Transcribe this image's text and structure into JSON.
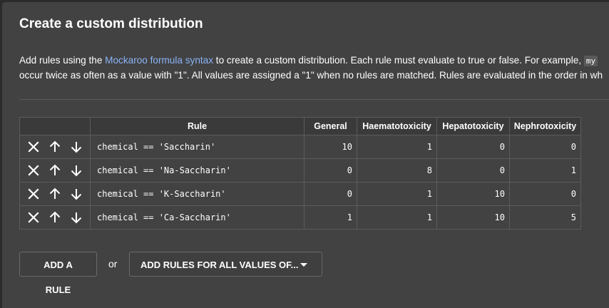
{
  "dialog": {
    "title": "Create a custom distribution",
    "description": {
      "part1": "Add rules using the ",
      "link": "Mockaroo formula syntax",
      "part2": " to create a custom distribution. Each rule must evaluate to true or false. For example, ",
      "code": "my",
      "line2": "occur twice as often as a value with \"1\". All values are assigned a \"1\" when no rules are matched. Rules are evaluated in the order in wh"
    }
  },
  "table": {
    "headers": [
      "",
      "Rule",
      "General",
      "Haematotoxicity",
      "Hepatotoxicity",
      "Nephrotoxicity"
    ],
    "rows": [
      {
        "rule": "chemical == 'Saccharin'",
        "general": "10",
        "haem": "1",
        "hep": "0",
        "neph": "0"
      },
      {
        "rule": "chemical == 'Na-Saccharin'",
        "general": "0",
        "haem": "8",
        "hep": "0",
        "neph": "1"
      },
      {
        "rule": "chemical == 'K-Saccharin'",
        "general": "0",
        "haem": "1",
        "hep": "10",
        "neph": "0"
      },
      {
        "rule": "chemical == 'Ca-Saccharin'",
        "general": "1",
        "haem": "1",
        "hep": "10",
        "neph": "5"
      }
    ]
  },
  "footer": {
    "add_rule": "ADD A RULE",
    "or": "or",
    "add_all": "ADD RULES FOR ALL VALUES OF..."
  },
  "icons": {
    "delete": "close-icon",
    "up": "arrow-up-icon",
    "down": "arrow-down-icon",
    "dropdown": "caret-down-icon"
  },
  "colors": {
    "background": "#424242",
    "link": "#8ab4f8",
    "border": "#5c5c5c"
  }
}
